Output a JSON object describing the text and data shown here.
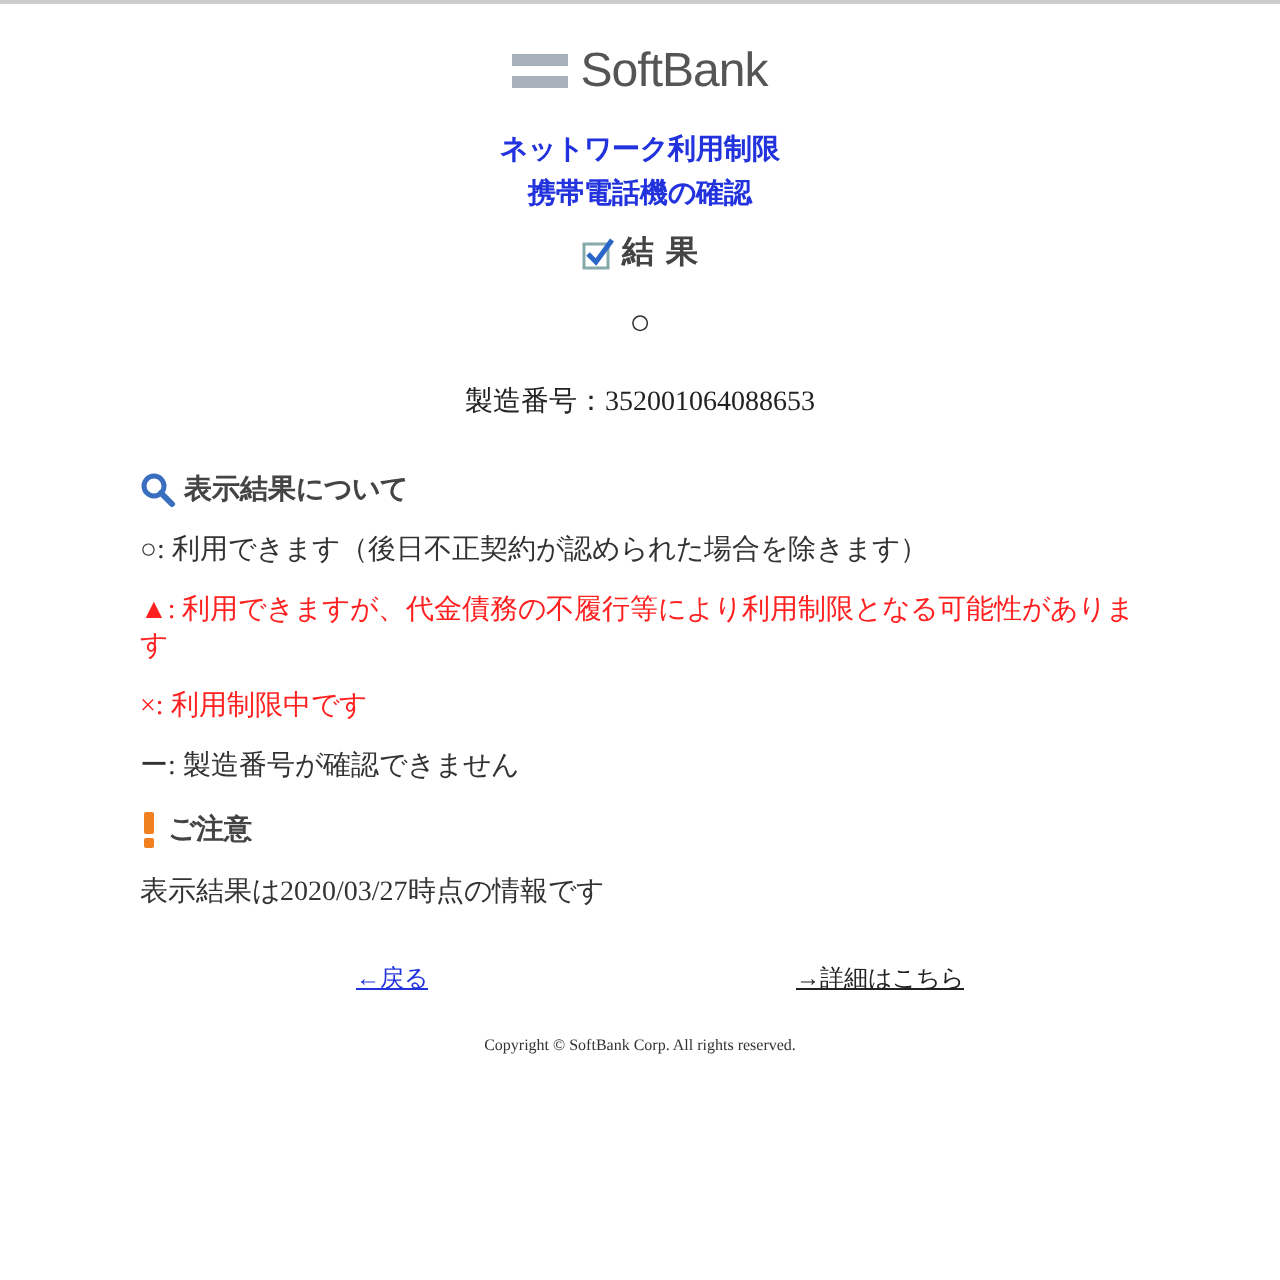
{
  "logo": {
    "text": "SoftBank"
  },
  "title_lines": [
    "ネットワーク利用制限",
    "携帯電話機の確認"
  ],
  "result": {
    "heading": "結 果",
    "symbol": "○",
    "serial": "製造番号：352001064088653"
  },
  "legend": {
    "heading": "表示結果について",
    "items": [
      {
        "text": "○: 利用できます（後日不正契約が認められた場合を除きます）",
        "color": "#333333"
      },
      {
        "text": "▲: 利用できますが、代金債務の不履行等により利用制限となる可能性があります",
        "color": "#ff2020"
      },
      {
        "text": "×: 利用制限中です",
        "color": "#ff2020"
      },
      {
        "text": "ー: 製造番号が確認できません",
        "color": "#333333"
      }
    ]
  },
  "notice": {
    "heading": "ご注意",
    "text": "表示結果は2020/03/27時点の情報です"
  },
  "links": [
    {
      "text": "←戻る",
      "color": "#2233dd"
    },
    {
      "text": "→詳細はこちら",
      "color": "#222222"
    }
  ],
  "copyright": "Copyright © SoftBank Corp. All rights reserved."
}
